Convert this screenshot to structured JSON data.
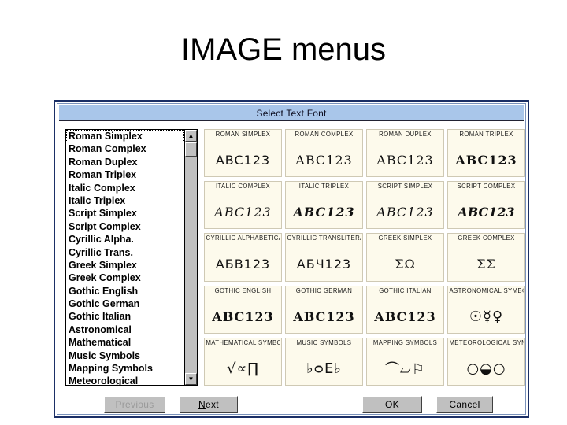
{
  "slide": {
    "title": "IMAGE menus",
    "background_color": "#ffffff"
  },
  "dialog": {
    "title": "Select Text Font",
    "title_bar_color": "#a9c6ea",
    "border_color": "#1b2f66",
    "body_color": "#ffffff",
    "preview_cell_color": "#fdfaec"
  },
  "font_list": {
    "selected_index": 0,
    "items": [
      {
        "label": "Roman Simplex"
      },
      {
        "label": "Roman Complex"
      },
      {
        "label": "Roman Duplex"
      },
      {
        "label": "Roman Triplex"
      },
      {
        "label": "Italic Complex"
      },
      {
        "label": "Italic Triplex"
      },
      {
        "label": "Script Simplex"
      },
      {
        "label": "Script Complex"
      },
      {
        "label": "Cyrillic Alpha."
      },
      {
        "label": "Cyrillic Trans."
      },
      {
        "label": "Greek Simplex"
      },
      {
        "label": "Greek Complex"
      },
      {
        "label": "Gothic English"
      },
      {
        "label": "Gothic German"
      },
      {
        "label": "Gothic Italian"
      },
      {
        "label": "Astronomical"
      },
      {
        "label": "Mathematical"
      },
      {
        "label": "Music Symbols"
      },
      {
        "label": "Mapping Symbols"
      },
      {
        "label": "Meteorological"
      }
    ],
    "scrollbar": {
      "up_arrow": "scroll-up-icon",
      "up_glyph": "▲",
      "down_arrow": "scroll-down-icon",
      "down_glyph": "▼"
    }
  },
  "preview_grid": {
    "cells": [
      {
        "label": "ROMAN SIMPLEX",
        "sample": "ABC123",
        "style": "s-simplex"
      },
      {
        "label": "ROMAN COMPLEX",
        "sample": "ABC123",
        "style": "s-complex"
      },
      {
        "label": "ROMAN DUPLEX",
        "sample": "ABC123",
        "style": "s-duplex"
      },
      {
        "label": "ROMAN TRIPLEX",
        "sample": "ABC123",
        "style": "s-triplex"
      },
      {
        "label": "ITALIC COMPLEX",
        "sample": "ABC123",
        "style": "s-italic"
      },
      {
        "label": "ITALIC TRIPLEX",
        "sample": "ABC123",
        "style": "s-italic-b"
      },
      {
        "label": "SCRIPT SIMPLEX",
        "sample": "ABC123",
        "style": "s-script"
      },
      {
        "label": "SCRIPT COMPLEX",
        "sample": "ABC123",
        "style": "s-script-b"
      },
      {
        "label": "CYRILLIC ALPHABETICAL",
        "sample": "АБВ123",
        "style": "s-cyr"
      },
      {
        "label": "CYRILLIC TRANSLITERAL",
        "sample": "АБЧ123",
        "style": "s-cyr"
      },
      {
        "label": "GREEK SIMPLEX",
        "sample": "ΣΩ",
        "style": "s-greek"
      },
      {
        "label": "GREEK COMPLEX",
        "sample": "ΣΣ",
        "style": "s-greek"
      },
      {
        "label": "GOTHIC ENGLISH",
        "sample": "ABC123",
        "style": "s-gothic"
      },
      {
        "label": "GOTHIC GERMAN",
        "sample": "ABC123",
        "style": "s-gothic"
      },
      {
        "label": "GOTHIC ITALIAN",
        "sample": "ABC123",
        "style": "s-gothic"
      },
      {
        "label": "ASTRONOMICAL SYMBOLS",
        "sample": "☉☿♀",
        "style": "s-sym"
      },
      {
        "label": "MATHEMATICAL SYMBOLS",
        "sample": "√∝∏",
        "style": "s-sym"
      },
      {
        "label": "MUSIC SYMBOLS",
        "sample": "♭ᴑE♭",
        "style": "s-sym"
      },
      {
        "label": "MAPPING SYMBOLS",
        "sample": "⌒▱⚐",
        "style": "s-sym"
      },
      {
        "label": "METEOROLOGICAL SYMBOLS",
        "sample": "○◒○",
        "style": "s-sym"
      }
    ]
  },
  "buttons": {
    "previous": {
      "label": "Previous",
      "enabled": false
    },
    "next": {
      "label": "Next",
      "mnemonic": "N",
      "rest": "ext",
      "enabled": true
    },
    "ok": {
      "label": "OK",
      "enabled": true
    },
    "cancel": {
      "label": "Cancel",
      "enabled": true
    }
  }
}
